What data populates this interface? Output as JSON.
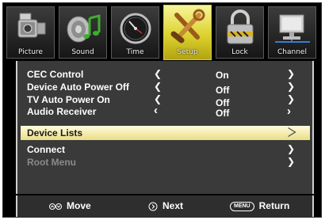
{
  "tabs": [
    {
      "label": "Picture",
      "icon": "camcorder-icon",
      "active": false
    },
    {
      "label": "Sound",
      "icon": "speaker-music-icon",
      "active": false
    },
    {
      "label": "Time",
      "icon": "clock-icon",
      "active": false
    },
    {
      "label": "Setup",
      "icon": "setup-tools-icon",
      "active": true
    },
    {
      "label": "Lock",
      "icon": "padlock-icon",
      "active": false
    },
    {
      "label": "Channel",
      "icon": "network-computer-icon",
      "active": false
    }
  ],
  "menu": {
    "cec_control": {
      "label": "CEC Control",
      "left_arrow": "❮",
      "value": "On",
      "right_arrow": "❯"
    },
    "device_auto_power_off": {
      "label": "Device Auto Power Off",
      "left_arrow": "❮",
      "value": "Off",
      "right_arrow": "❯"
    },
    "tv_auto_power_on": {
      "label": "TV Auto Power On",
      "left_arrow": "❮",
      "value": "Off",
      "right_arrow": "❯"
    },
    "audio_receiver": {
      "label": "Audio Receiver",
      "left_arrow": "‹",
      "value": "Off",
      "right_arrow": "›"
    },
    "device_lists": {
      "label": "Device Lists",
      "selected": true
    },
    "connect": {
      "label": "Connect",
      "right_arrow": "❯"
    },
    "root_menu": {
      "label": "Root Menu",
      "right_arrow": "❯",
      "disabled": true
    }
  },
  "footer": {
    "move": {
      "label": "Move",
      "icon": "up-down-arrows-icon"
    },
    "next": {
      "label": "Next",
      "icon": "right-circle-icon"
    },
    "return": {
      "label": "Return",
      "key": "MENU"
    }
  },
  "colors": {
    "active_tab": "#dcd22f",
    "selected_row": "#f3e9a6",
    "panel_bg": "#3a3a3a",
    "disabled_text": "#8a8a8a"
  }
}
